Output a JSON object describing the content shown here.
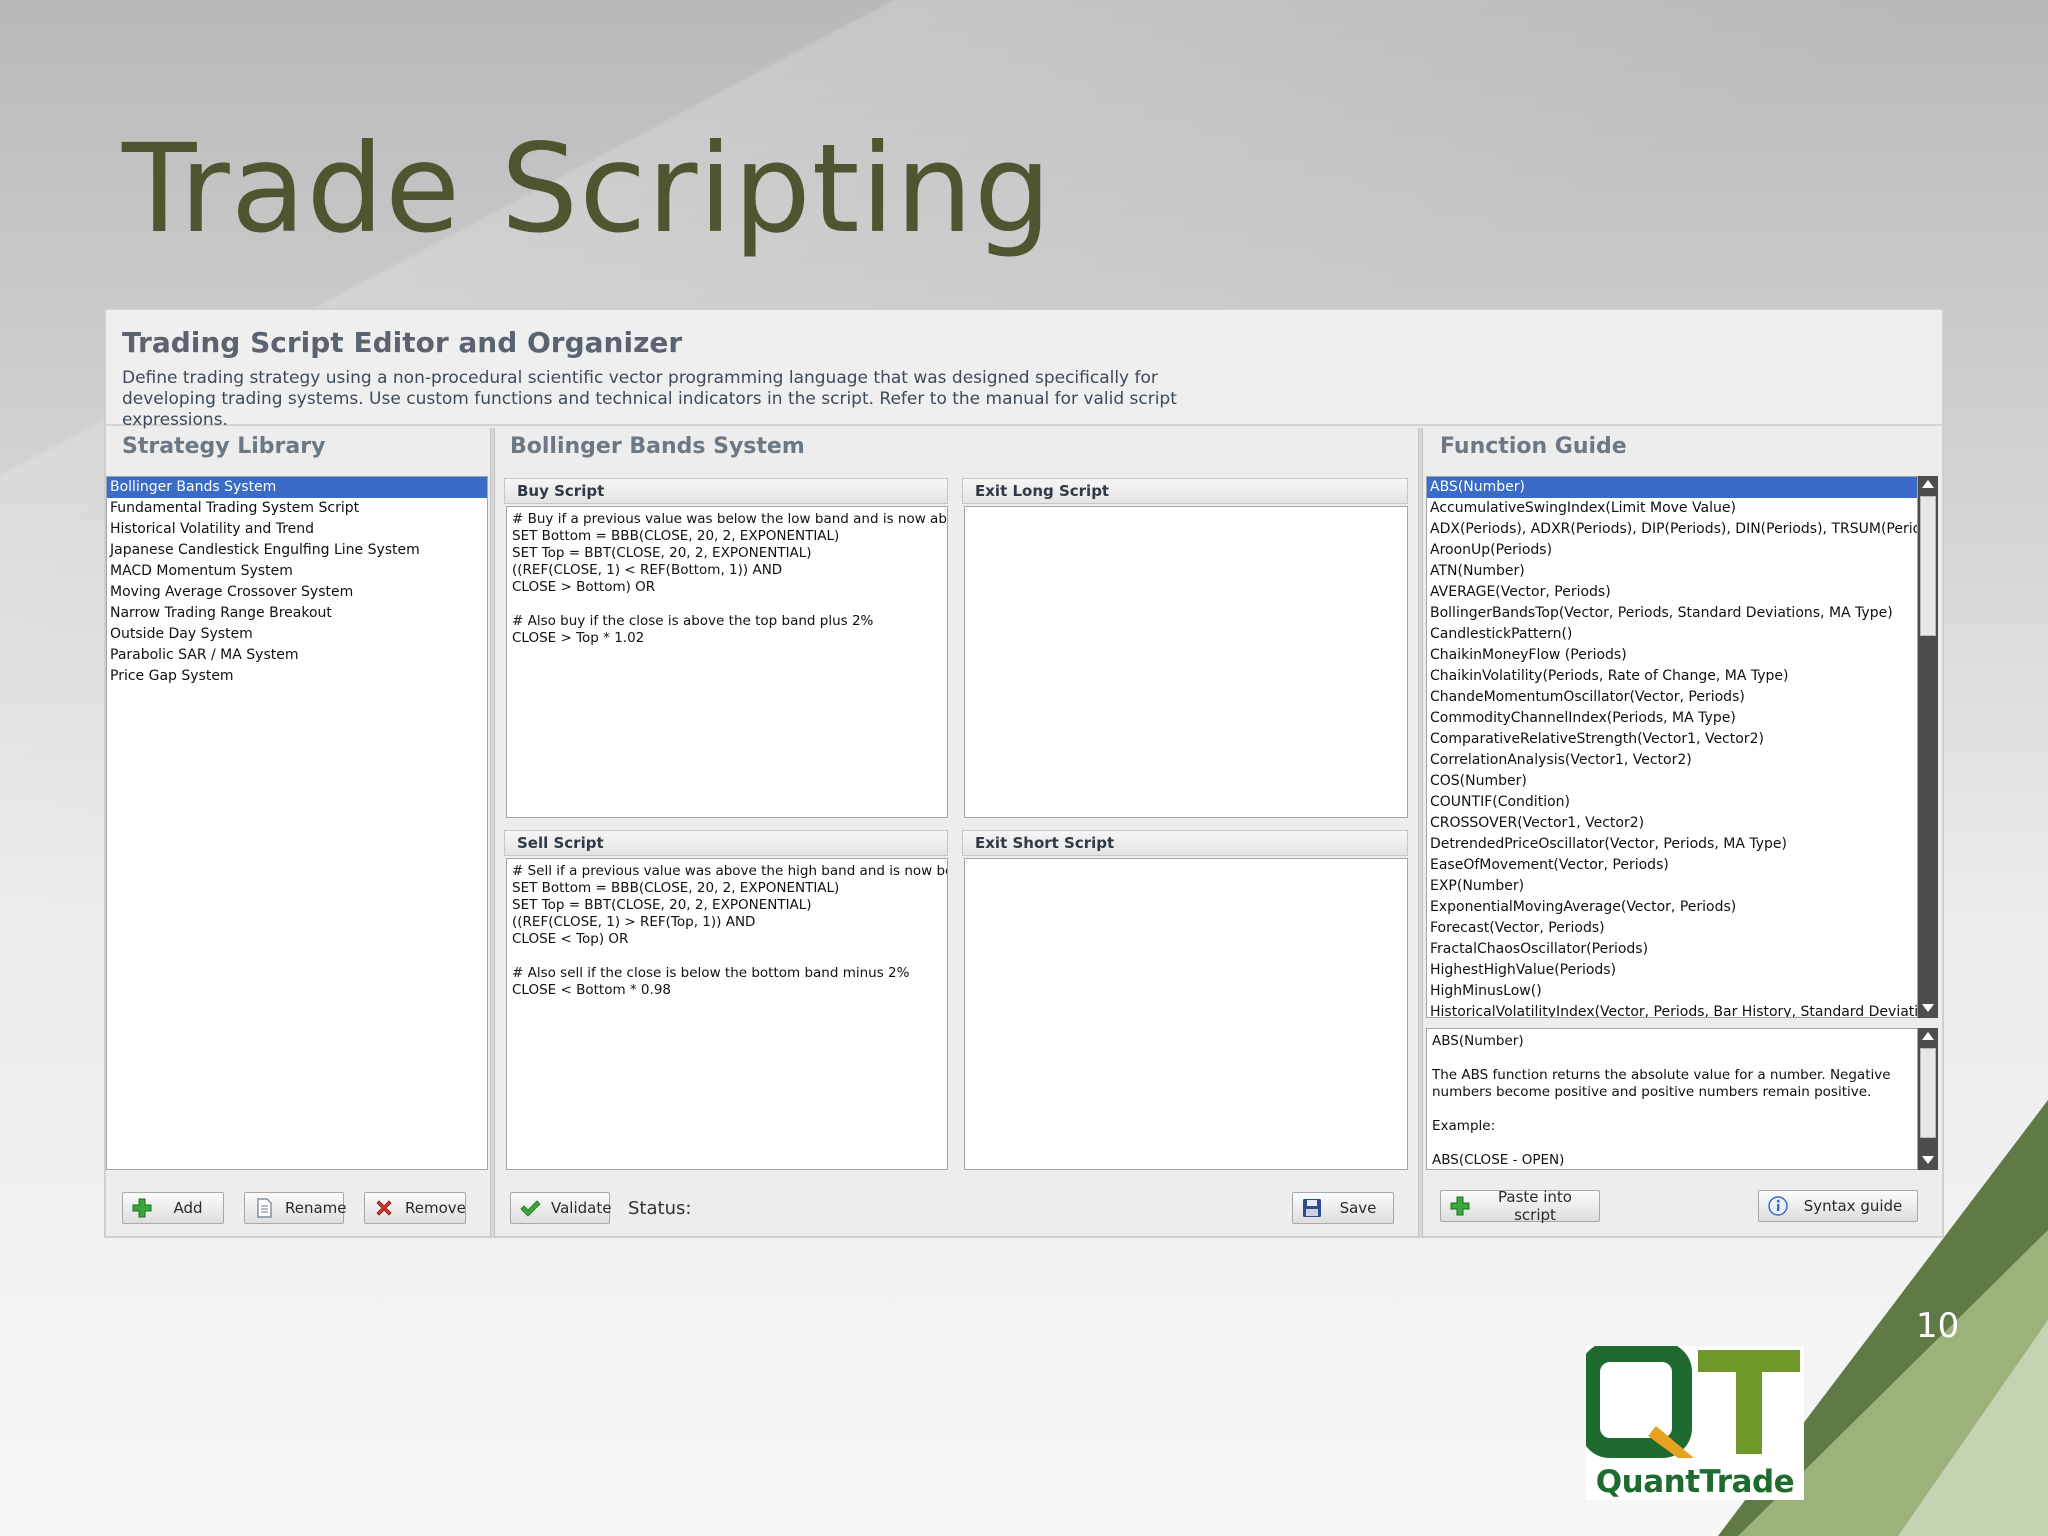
{
  "slide": {
    "title": "Trade Scripting",
    "page_number": "10",
    "logo_text": "QuantTrade"
  },
  "window": {
    "title": "Trading Script Editor and Organizer",
    "description": "Define trading strategy using a non-procedural scientific vector programming language that was designed specifically for developing trading systems. Use custom functions and technical indicators in the script. Refer to the manual for valid script expressions."
  },
  "library": {
    "title": "Strategy Library",
    "items": [
      "Bollinger Bands System",
      "Fundamental Trading System Script",
      "Historical Volatility and Trend",
      "Japanese Candlestick Engulfing Line System",
      "MACD Momentum System",
      "Moving Average Crossover System",
      "Narrow Trading Range Breakout",
      "Outside Day System",
      "Parabolic SAR / MA System",
      "Price Gap System"
    ],
    "selected_index": 0,
    "add_label": "Add",
    "rename_label": "Rename",
    "remove_label": "Remove"
  },
  "editor": {
    "title": "Bollinger Bands System",
    "buy_label": "Buy Script",
    "buy_script": "# Buy if a previous value was below the low band and is now above\nSET Bottom = BBB(CLOSE, 20, 2, EXPONENTIAL)\nSET Top = BBT(CLOSE, 20, 2, EXPONENTIAL)\n((REF(CLOSE, 1) < REF(Bottom, 1)) AND\nCLOSE > Bottom) OR\n\n# Also buy if the close is above the top band plus 2%\nCLOSE > Top * 1.02",
    "exit_long_label": "Exit Long Script",
    "exit_long_script": "",
    "sell_label": "Sell Script",
    "sell_script": "# Sell if a previous value was above the high band and is now below\nSET Bottom = BBB(CLOSE, 20, 2, EXPONENTIAL)\nSET Top = BBT(CLOSE, 20, 2, EXPONENTIAL)\n((REF(CLOSE, 1) > REF(Top, 1)) AND\nCLOSE < Top) OR\n\n# Also sell if the close is below the bottom band minus 2%\nCLOSE < Bottom * 0.98",
    "exit_short_label": "Exit Short Script",
    "exit_short_script": "",
    "validate_label": "Validate",
    "status_label": "Status:",
    "save_label": "Save"
  },
  "functions": {
    "title": "Function Guide",
    "items": [
      "ABS(Number)",
      "AccumulativeSwingIndex(Limit Move Value)",
      "ADX(Periods), ADXR(Periods), DIP(Periods), DIN(Periods), TRSUM(Periods), D",
      "AroonUp(Periods)",
      "ATN(Number)",
      "AVERAGE(Vector, Periods)",
      "BollingerBandsTop(Vector, Periods, Standard Deviations, MA Type)",
      "CandlestickPattern()",
      "ChaikinMoneyFlow (Periods)",
      "ChaikinVolatility(Periods, Rate of Change, MA Type)",
      "ChandeMomentumOscillator(Vector, Periods)",
      "CommodityChannelIndex(Periods, MA Type)",
      "ComparativeRelativeStrength(Vector1, Vector2)",
      "CorrelationAnalysis(Vector1, Vector2)",
      "COS(Number)",
      "COUNTIF(Condition)",
      "CROSSOVER(Vector1, Vector2)",
      "DetrendedPriceOscillator(Vector, Periods, MA Type)",
      "EaseOfMovement(Vector, Periods)",
      "EXP(Number)",
      "ExponentialMovingAverage(Vector, Periods)",
      "Forecast(Vector, Periods)",
      "FractalChaosOscillator(Periods)",
      "HighestHighValue(Periods)",
      "HighMinusLow()",
      "HistoricalVolatilityIndex(Vector, Periods, Bar History, Standard Deviations)"
    ],
    "selected_index": 0,
    "description": "ABS(Number)\n\nThe ABS function returns the absolute value for a number. Negative numbers become positive and positive numbers remain positive.\n\nExample:\n\nABS(CLOSE - OPEN)",
    "paste_label": "Paste into script",
    "syntax_label": "Syntax guide"
  },
  "colors": {
    "selection": "#3a6bc7",
    "title_olive": "#4d5630",
    "accent_green": "#5f7a44"
  }
}
